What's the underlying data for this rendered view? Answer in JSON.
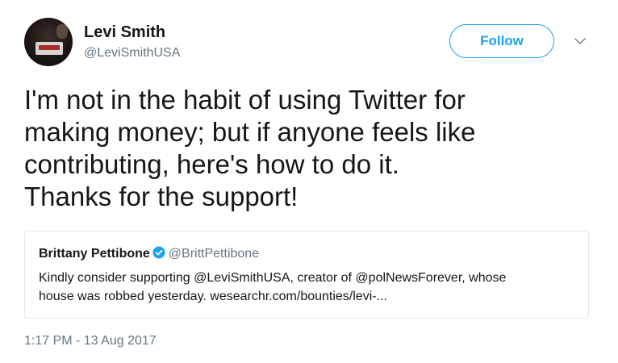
{
  "author": {
    "name": "Levi Smith",
    "handle": "@LeviSmithUSA"
  },
  "follow_label": "Follow",
  "icons": {
    "more": "chevron-down-icon",
    "verified": "verified-badge-icon"
  },
  "colors": {
    "accent": "#1da1f2",
    "text": "#14171a",
    "secondary": "#657786",
    "border": "#e1e8ed"
  },
  "tweet": {
    "lines": [
      "I'm not in the habit of using Twitter for",
      "making money; but if anyone feels like",
      "contributing, here's how to do it.",
      "Thanks for the support!"
    ],
    "timestamp": "1:17 PM - 13 Aug 2017"
  },
  "quoted": {
    "name": "Brittany Pettibone",
    "handle": "@BrittPettibone",
    "lines": [
      "Kindly consider supporting @LeviSmithUSA, creator of @polNewsForever, whose",
      "house was robbed yesterday. wesearchr.com/bounties/levi-..."
    ]
  }
}
